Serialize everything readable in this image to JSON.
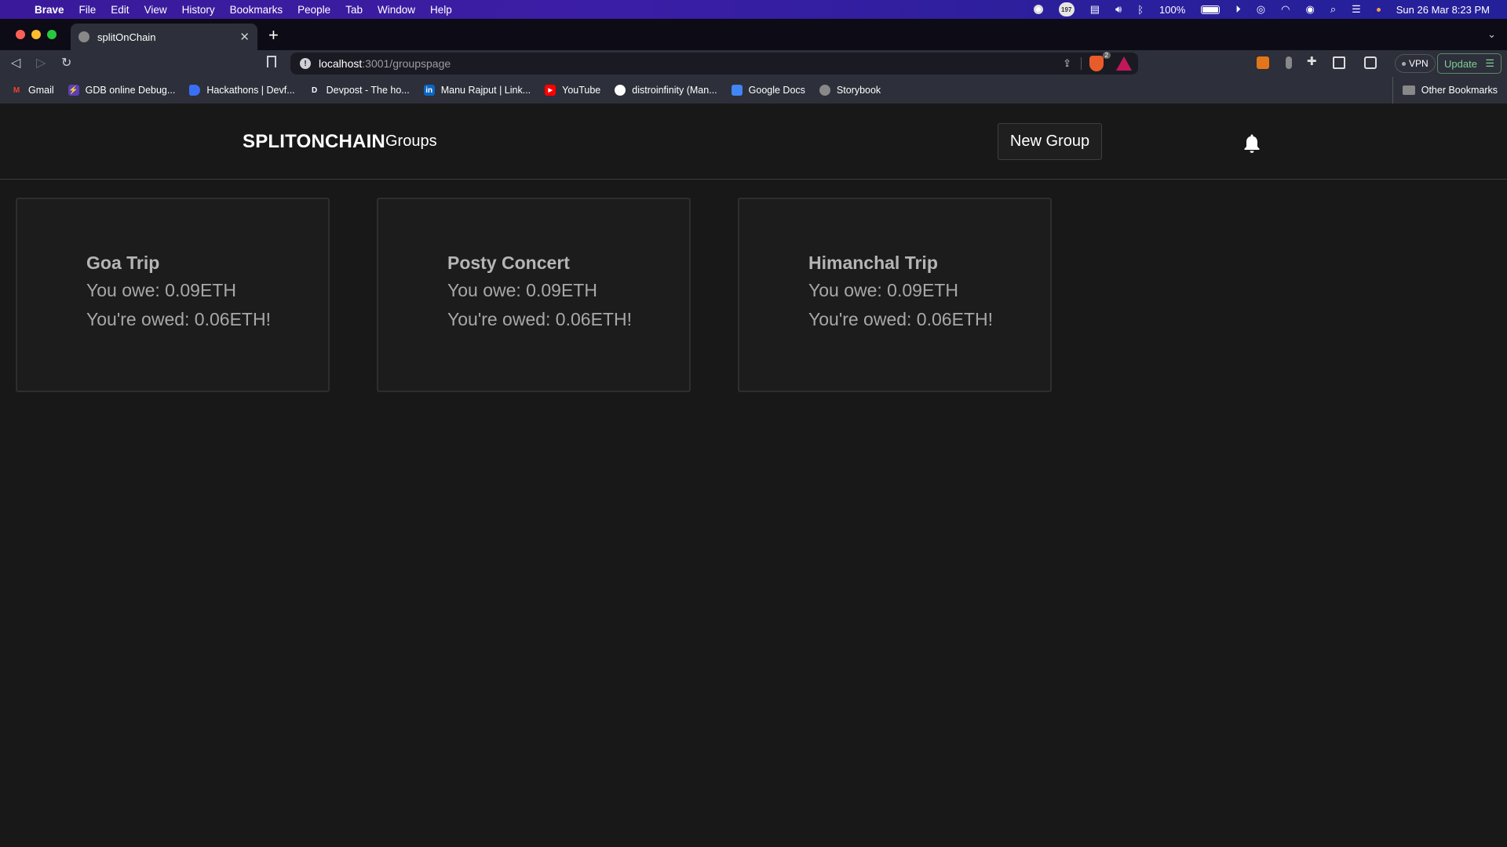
{
  "menubar": {
    "app_name": "Brave",
    "menus": [
      "File",
      "Edit",
      "View",
      "History",
      "Bookmarks",
      "People",
      "Tab",
      "Window",
      "Help"
    ],
    "status": {
      "notification_badge": "197",
      "battery": "100%",
      "datetime": "Sun 26 Mar  8:23 PM"
    }
  },
  "browser": {
    "tab_title": "splitOnChain",
    "url_host": "localhost",
    "url_path": ":3001/groupspage",
    "shields_count": "2",
    "vpn_label": "VPN",
    "update_label": "Update",
    "bookmarks": [
      {
        "label": "Gmail",
        "icon": "M"
      },
      {
        "label": "GDB online Debug...",
        "icon": "⚡"
      },
      {
        "label": "Hackathons | Devf...",
        "icon": ""
      },
      {
        "label": "Devpost - The ho...",
        "icon": "D"
      },
      {
        "label": "Manu Rajput | Link...",
        "icon": "in"
      },
      {
        "label": "YouTube",
        "icon": "▶"
      },
      {
        "label": "distroinfinity (Man...",
        "icon": ""
      },
      {
        "label": "Google Docs",
        "icon": ""
      },
      {
        "label": "Storybook",
        "icon": ""
      }
    ],
    "other_bookmarks": "Other Bookmarks"
  },
  "app": {
    "brand": "SPLITONCHAIN",
    "nav_groups": "Groups",
    "new_group_label": "New Group",
    "groups": [
      {
        "name": "Goa Trip",
        "owe": "You owe: 0.09ETH",
        "owed": "You're owed: 0.06ETH!"
      },
      {
        "name": "Posty Concert",
        "owe": "You owe: 0.09ETH",
        "owed": "You're owed: 0.06ETH!"
      },
      {
        "name": "Himanchal Trip",
        "owe": "You owe: 0.09ETH",
        "owed": "You're owed: 0.06ETH!"
      }
    ]
  }
}
